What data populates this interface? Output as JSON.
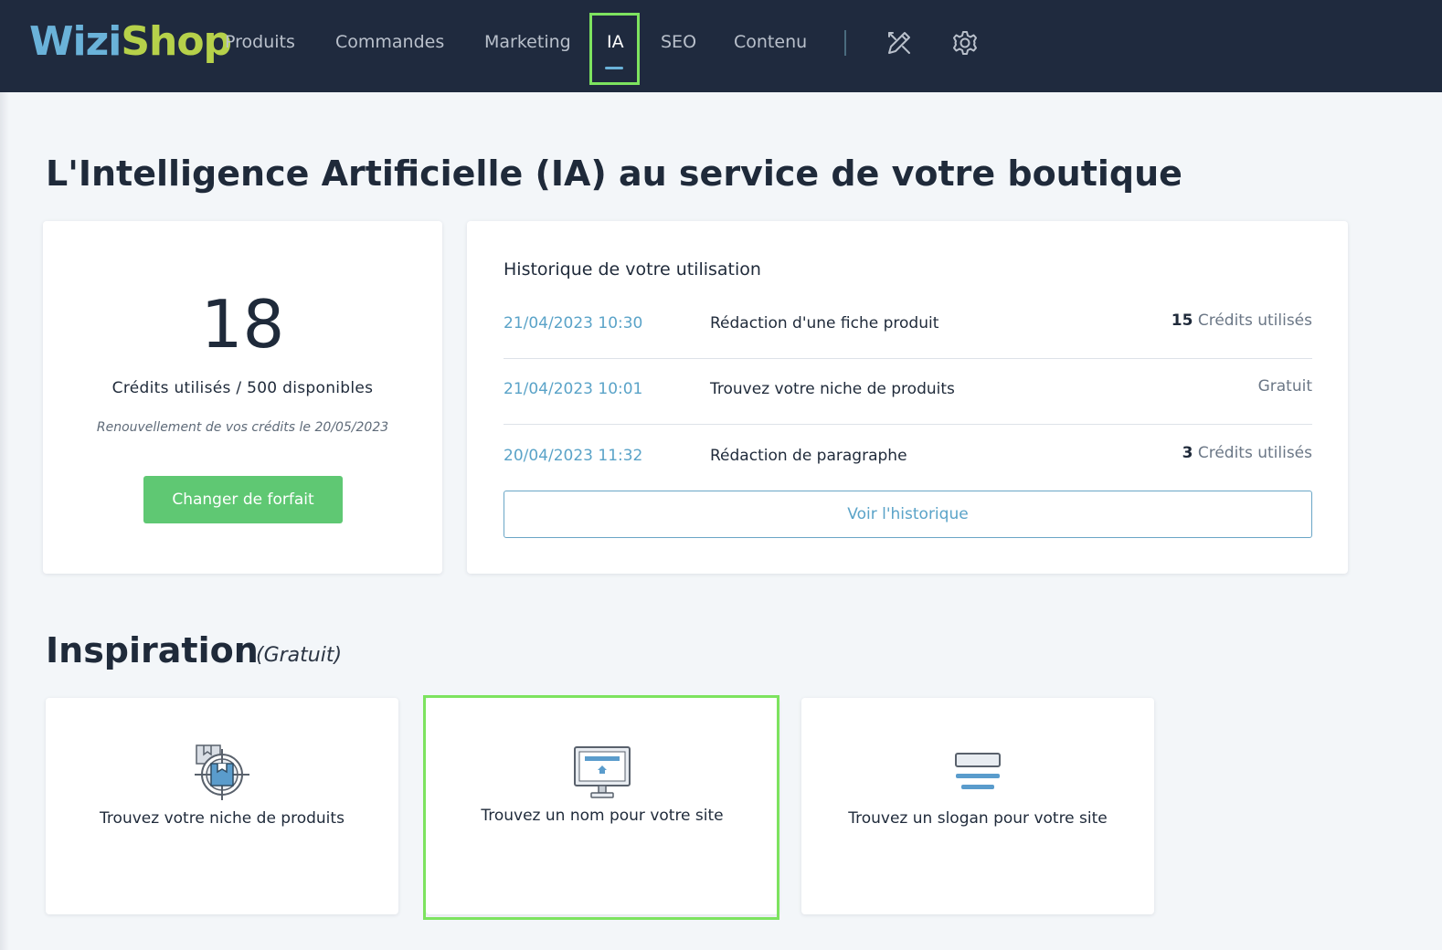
{
  "header": {
    "logo_part1": "Wizi",
    "logo_part2": "Shop",
    "nav": [
      "Produits",
      "Commandes",
      "Marketing",
      "IA",
      "SEO",
      "Contenu"
    ],
    "active_nav": "IA",
    "icons": [
      "design-tools-icon",
      "gear-icon"
    ]
  },
  "page_title": "L'Intelligence Artificielle (IA) au service de votre boutique",
  "credits": {
    "used": "18",
    "label": "Crédits utilisés / 500 disponibles",
    "renewal": "Renouvellement de vos crédits le 20/05/2023",
    "button": "Changer de forfait"
  },
  "history": {
    "title": "Historique de votre utilisation",
    "rows": [
      {
        "date": "21/04/2023 10:30",
        "action": "Rédaction d'une fiche produit",
        "credits_num": "15",
        "credits_text": "Crédits utilisés"
      },
      {
        "date": "21/04/2023 10:01",
        "action": "Trouvez votre niche de produits",
        "credits_num": "",
        "credits_text": "Gratuit"
      },
      {
        "date": "20/04/2023 11:32",
        "action": "Rédaction de paragraphe",
        "credits_num": "3",
        "credits_text": "Crédits utilisés"
      }
    ],
    "button": "Voir l'historique"
  },
  "inspiration": {
    "title": "Inspiration",
    "subtitle": "(Gratuit)",
    "tools": [
      {
        "label": "Trouvez votre niche de produits",
        "icon": "product-target-icon"
      },
      {
        "label": "Trouvez un nom pour votre site",
        "icon": "monitor-icon"
      },
      {
        "label": "Trouvez un slogan pour votre site",
        "icon": "slogan-lines-icon"
      }
    ]
  },
  "colors": {
    "topbar": "#1f2a3e",
    "accent_green": "#5fc873",
    "link_blue": "#5aa3c8",
    "highlight": "#7de35f"
  }
}
